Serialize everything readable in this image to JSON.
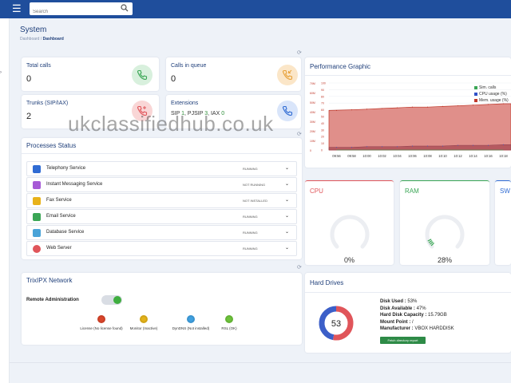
{
  "header": {
    "search_placeholder": "Search",
    "menu_icon": "hamburger-icon",
    "search_icon": "magnifier-icon"
  },
  "page": {
    "title": "System",
    "breadcrumb": {
      "parent": "Dashboard",
      "separator": "/",
      "current": "Dashboard"
    }
  },
  "stats": {
    "total_calls": {
      "label": "Total calls",
      "value": "0",
      "icon": "phone-icon",
      "color": "#3aa655"
    },
    "calls_in_queue": {
      "label": "Calls in queue",
      "value": "0",
      "icon": "phone-incoming-icon",
      "color": "#e8a23a"
    },
    "trunks": {
      "label": "Trunks (SIP/IAX)",
      "value": "2",
      "icon": "phone-add-icon",
      "color": "#e0555a"
    },
    "extensions": {
      "label": "Extensions",
      "sip_label": "SIP",
      "sip_count": "1",
      "pjsip_label": "PJSIP",
      "pjsip_count": "3",
      "iax_label": "IAX",
      "iax_count": "0",
      "icon": "phone-icon",
      "color": "#2f6bd3"
    }
  },
  "processes": {
    "title": "Processes Status",
    "items": [
      {
        "name": "Telephony Service",
        "status": "RUNNING",
        "icon": "telephony-icon"
      },
      {
        "name": "Instant Messaging Service",
        "status": "NOT RUNNING",
        "icon": "chat-icon"
      },
      {
        "name": "Fax Service",
        "status": "NOT INSTALLED",
        "icon": "fax-icon"
      },
      {
        "name": "Email Service",
        "status": "RUNNING",
        "icon": "email-icon"
      },
      {
        "name": "Database Service",
        "status": "RUNNING",
        "icon": "database-icon"
      },
      {
        "name": "Web Server",
        "status": "RUNNING",
        "icon": "web-server-icon"
      }
    ]
  },
  "network": {
    "title": "TrixIPX Network",
    "remote_admin_label": "Remote Administration",
    "remote_admin_on": true,
    "indicators": [
      {
        "label": "License (No license found)",
        "color": "#d9452a"
      },
      {
        "label": "Monitor (Inactive)",
        "color": "#e3b21a"
      },
      {
        "label": "DynDNS (Not installed)",
        "color": "#3fa0e0"
      },
      {
        "label": "RSL (OK)",
        "color": "#6cc23a"
      }
    ]
  },
  "performance": {
    "title": "Performance Graphic",
    "legend": [
      {
        "label": "Sim. calls",
        "color": "#3aa655"
      },
      {
        "label": "CPU usage (%)",
        "color": "#2f50c8"
      },
      {
        "label": "Mem. usage (%)",
        "color": "#c0392b"
      }
    ]
  },
  "chart_data": {
    "type": "area",
    "title": "Performance Graphic",
    "x": [
      "09:56",
      "09:58",
      "10:00",
      "10:02",
      "10:04",
      "10:06",
      "10:08",
      "10:10",
      "10:12",
      "10:14",
      "10:16",
      "10:18"
    ],
    "series": [
      {
        "name": "Mem. usage (%)",
        "values": [
          59,
          60,
          61,
          62,
          63,
          64,
          64,
          65,
          66,
          67,
          68,
          69
        ]
      },
      {
        "name": "CPU usage (%)",
        "values": [
          4,
          4,
          5,
          5,
          5,
          6,
          6,
          6,
          7,
          7,
          7,
          8
        ]
      },
      {
        "name": "Sim. calls",
        "values": [
          0,
          0,
          0,
          0,
          0,
          0,
          0,
          0,
          0,
          0,
          0,
          0
        ]
      }
    ],
    "left_axis_ticks": [
      "70M",
      "60M",
      "50M",
      "40M",
      "30M",
      "20M",
      "10M",
      "0"
    ],
    "right_axis_ticks": [
      "100",
      "90",
      "80",
      "70",
      "60",
      "50",
      "40",
      "30",
      "20",
      "10",
      "0"
    ],
    "ylim": [
      0,
      100
    ],
    "grid": true,
    "legend_position": "top-right"
  },
  "gauges": {
    "cpu": {
      "label": "CPU",
      "value": "0%",
      "percent": 0,
      "color": "#e0555a"
    },
    "ram": {
      "label": "RAM",
      "value": "28%",
      "percent": 28,
      "color": "#3aa655"
    },
    "swap": {
      "label": "SW",
      "color": "#2f6bd3"
    }
  },
  "hard_drives": {
    "title": "Hard Drives",
    "donut_value": "53",
    "used_percent": 53,
    "used_color": "#e0555a",
    "free_color": "#3c5fc8",
    "disk_used_label": "Disk Used :",
    "disk_used": "53%",
    "disk_available_label": "Disk Available :",
    "disk_available": "47%",
    "capacity_label": "Hard Disk Capacity :",
    "capacity": "15.79GB",
    "mount_label": "Mount Point :",
    "mount": "/",
    "manufacturer_label": "Manufacturer :",
    "manufacturer": "VBOX HARDDISK",
    "fetch_button": "Fetch directory report"
  },
  "watermark": "ukclassifiedhub.co.uk"
}
